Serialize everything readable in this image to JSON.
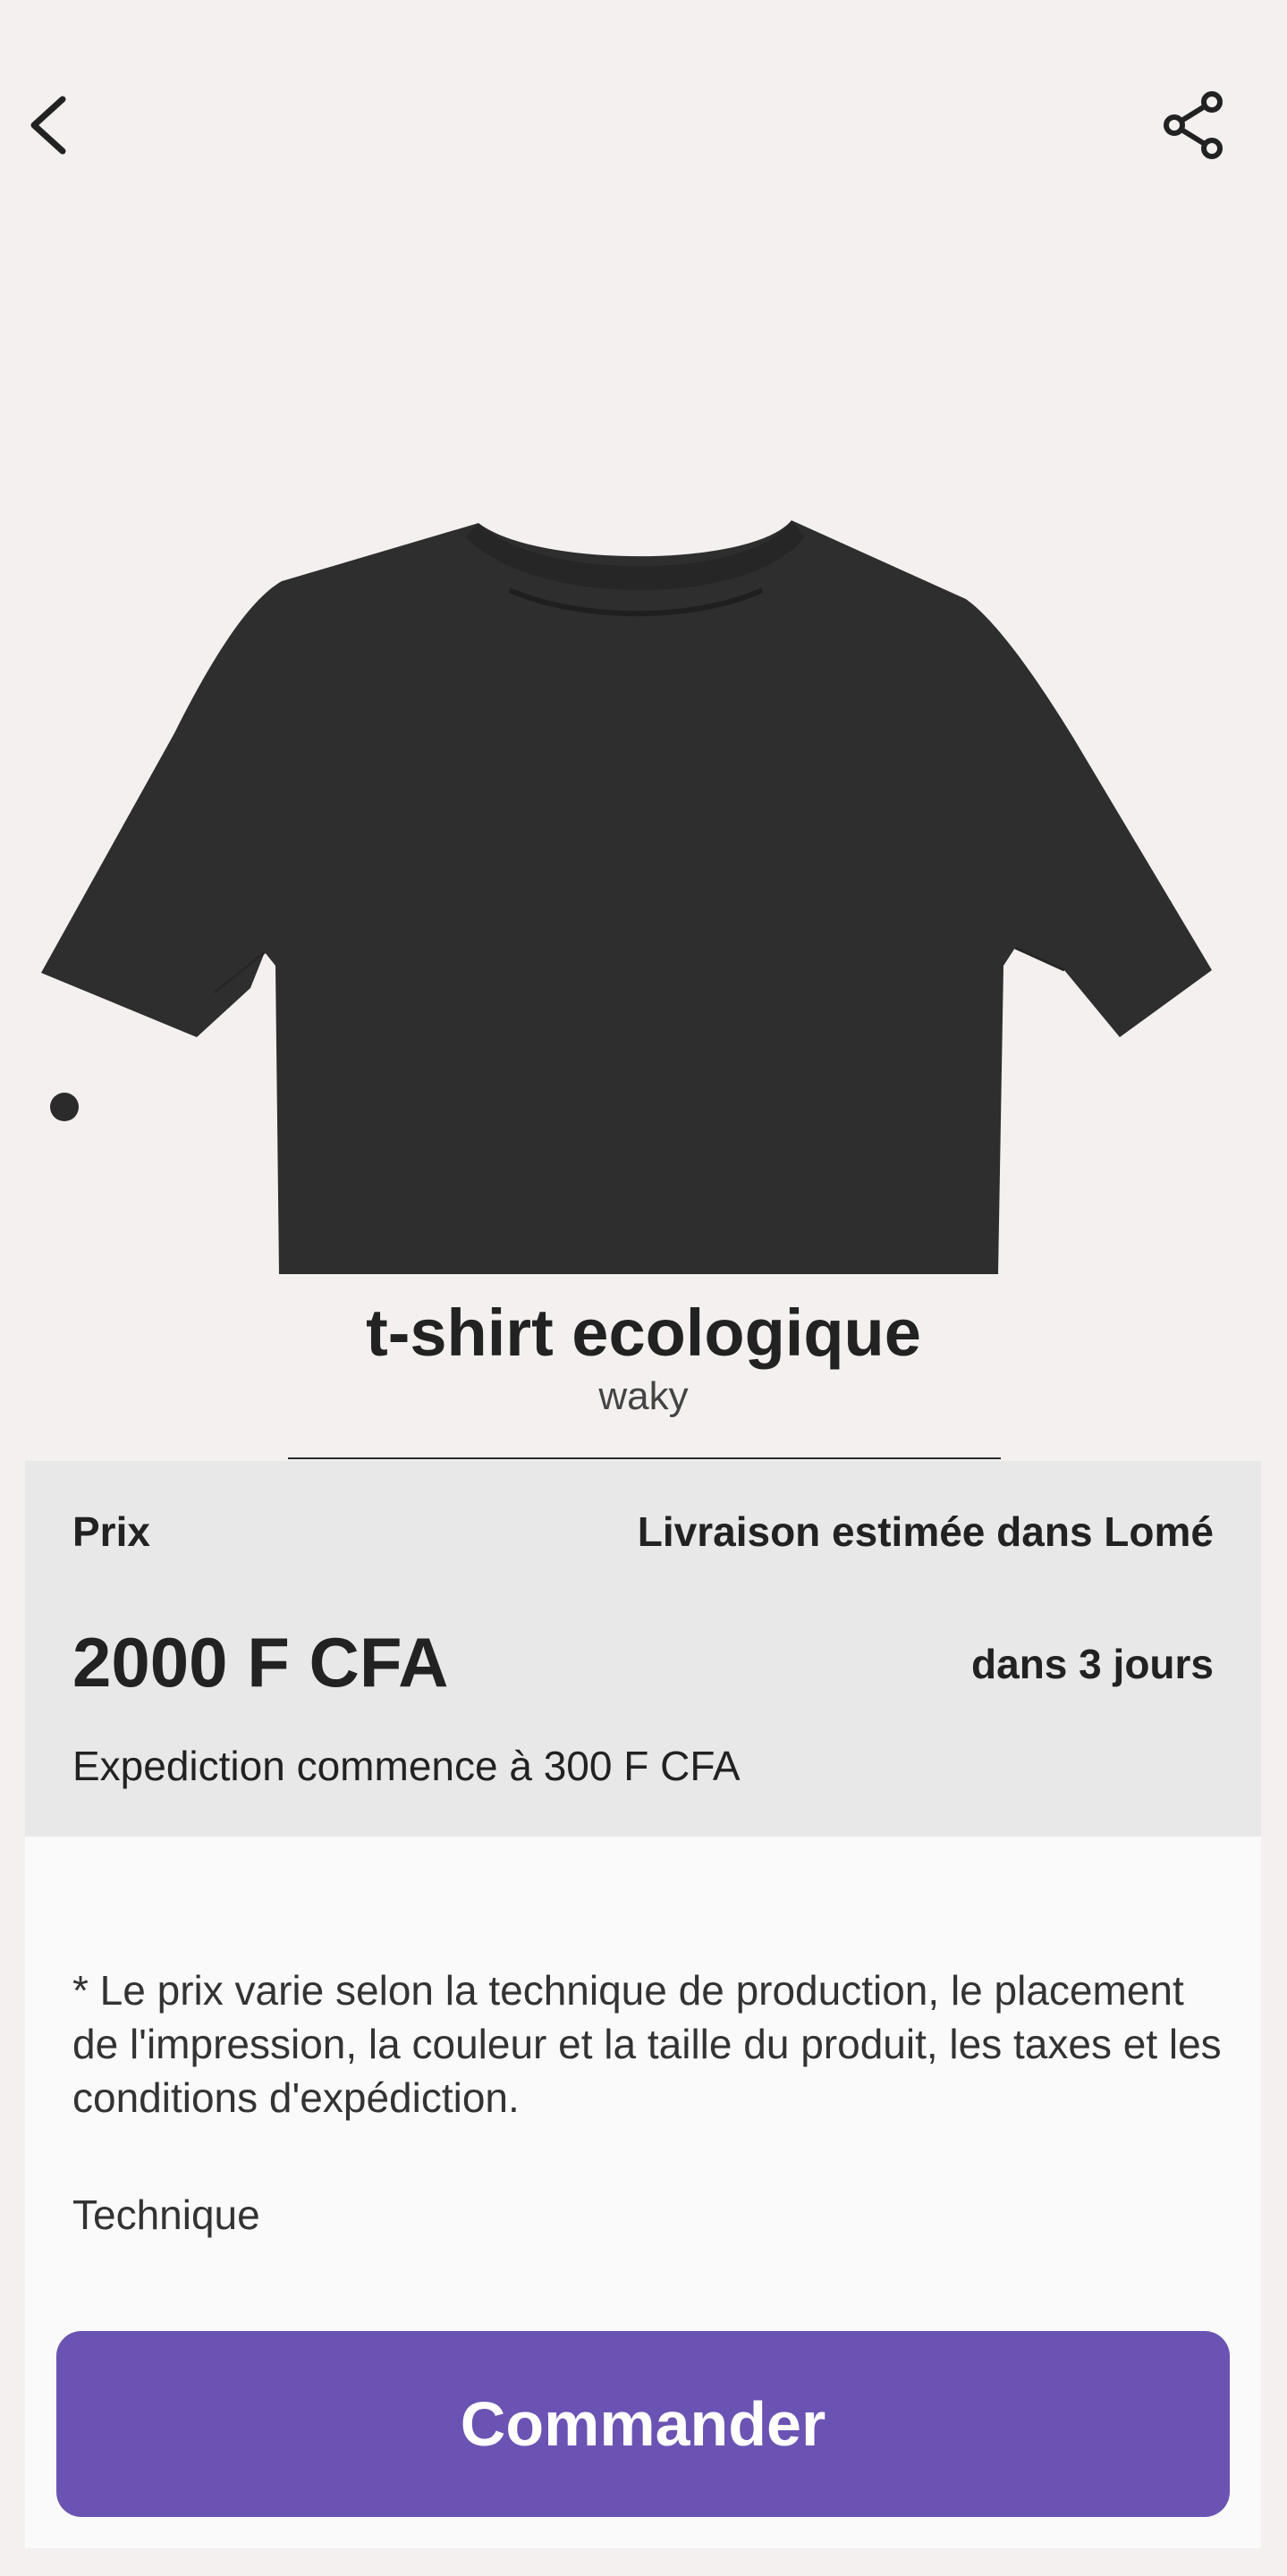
{
  "header": {
    "back_icon": "chevron-left-icon",
    "share_icon": "share-icon"
  },
  "gallery": {
    "image_subject": "black t-shirt",
    "dot_count": 1,
    "active_dot": 1
  },
  "product": {
    "title": "t-shirt ecologique",
    "brand": "waky"
  },
  "pricing": {
    "price_label": "Prix",
    "price_value": "2000 F CFA",
    "delivery_label": "Livraison estimée dans Lomé",
    "delivery_time": "dans 3 jours",
    "shipping_note": "Expediction commence à 300 F CFA"
  },
  "details": {
    "disclaimer": "* Le prix varie selon la technique de production, le placement de l'impression, la couleur et la taille du produit, les taxes et les conditions d'expédiction.",
    "technique_label": "Technique"
  },
  "actions": {
    "order_label": "Commander"
  },
  "colors": {
    "background": "#f3f0ef",
    "price_panel": "#e8e8e8",
    "details_panel": "#fafafa",
    "accent": "#6b53b4",
    "shirt": "#2e2e2e"
  }
}
